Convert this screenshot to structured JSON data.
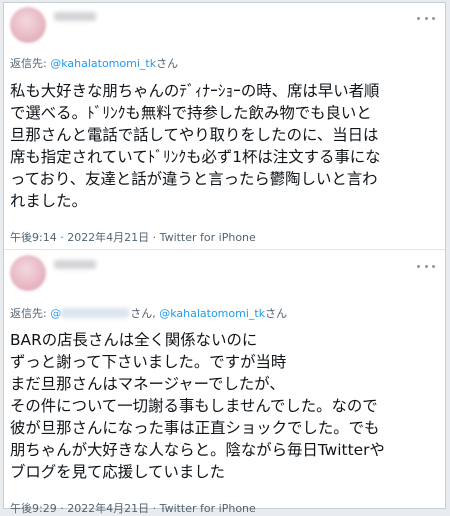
{
  "tweets": [
    {
      "reply_prefix": "返信先: ",
      "reply_handle": "@kahalatomomi_tk",
      "reply_suffix": "さん",
      "lines": [
        "私も大好きな朋ちゃんのﾃﾞｨﾅｰｼｮｰの時、席は早い者順",
        "で選べる。ﾄﾞﾘﾝｸも無料で持参した飲み物でも良いと",
        "旦那さんと電話で話してやり取りをしたのに、当日は",
        "席も指定されていてﾄﾞﾘﾝｸも必ず1杯は注文する事にな",
        "っており、友達と話が違うと言ったら鬱陶しいと言わ",
        "れました。"
      ],
      "meta": "午後9:14 · 2022年4月21日 · Twitter for iPhone"
    },
    {
      "reply_prefix": "返信先: ",
      "reply_first": "@",
      "reply_middle": "さん, ",
      "reply_handle": "@kahalatomomi_tk",
      "reply_suffix": "さん",
      "lines": [
        "BARの店長さんは全く関係ないのに",
        "ずっと謝って下さいました。ですが当時",
        "まだ旦那さんはマネージャーでしたが、",
        "その件について一切謝る事もしませんでした。なので",
        "彼が旦那さんになった事は正直ショックでした。でも",
        "朋ちゃんが大好きな人ならと。陰ながら毎日Twitterや",
        "ブログを見て応援していました"
      ],
      "meta": "午後9:29 · 2022年4月21日 · Twitter for iPhone"
    }
  ],
  "colors": {
    "link": "#1d9bf0",
    "muted": "#536471",
    "text": "#0f1419"
  }
}
